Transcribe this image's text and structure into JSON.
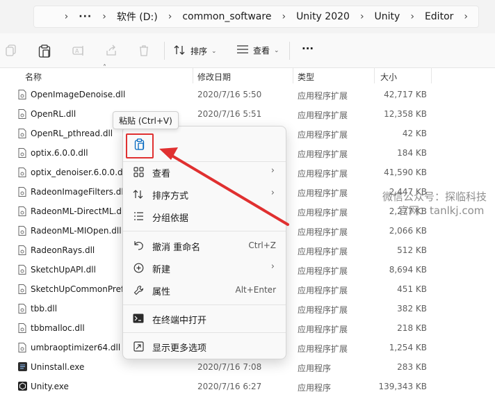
{
  "address": {
    "crumbs": [
      "软件 (D:)",
      "common_software",
      "Unity 2020",
      "Unity",
      "Editor"
    ],
    "overflow": "···"
  },
  "toolbar": {
    "sort_label": "排序",
    "view_label": "查看",
    "more_label": "···"
  },
  "columns": {
    "name": "名称",
    "date": "修改日期",
    "type": "类型",
    "size": "大小"
  },
  "files": [
    {
      "name": "OpenImageDenoise.dll",
      "date": "2020/7/16 5:50",
      "type": "应用程序扩展",
      "size": "42,717 KB",
      "icon": "dll-file-icon"
    },
    {
      "name": "OpenRL.dll",
      "date": "2020/7/16 5:51",
      "type": "应用程序扩展",
      "size": "12,358 KB",
      "icon": "dll-file-icon"
    },
    {
      "name": "OpenRL_pthread.dll",
      "date": "",
      "type": "应用程序扩展",
      "size": "42 KB",
      "icon": "dll-file-icon"
    },
    {
      "name": "optix.6.0.0.dll",
      "date": "",
      "type": "应用程序扩展",
      "size": "184 KB",
      "icon": "dll-file-icon"
    },
    {
      "name": "optix_denoiser.6.0.0.dll",
      "date": "",
      "type": "应用程序扩展",
      "size": "41,590 KB",
      "icon": "dll-file-icon"
    },
    {
      "name": "RadeonImageFilters.dll",
      "date": "",
      "type": "应用程序扩展",
      "size": "2,447 KB",
      "icon": "dll-file-icon"
    },
    {
      "name": "RadeonML-DirectML.dll",
      "date": "",
      "type": "应用程序扩展",
      "size": "2,277 KB",
      "icon": "dll-file-icon"
    },
    {
      "name": "RadeonML-MIOpen.dll",
      "date": "",
      "type": "应用程序扩展",
      "size": "2,066 KB",
      "icon": "dll-file-icon"
    },
    {
      "name": "RadeonRays.dll",
      "date": "",
      "type": "应用程序扩展",
      "size": "512 KB",
      "icon": "dll-file-icon"
    },
    {
      "name": "SketchUpAPI.dll",
      "date": "",
      "type": "应用程序扩展",
      "size": "8,694 KB",
      "icon": "dll-file-icon"
    },
    {
      "name": "SketchUpCommonPreferences.dll",
      "date": "",
      "type": "应用程序扩展",
      "size": "451 KB",
      "icon": "dll-file-icon"
    },
    {
      "name": "tbb.dll",
      "date": "",
      "type": "应用程序扩展",
      "size": "382 KB",
      "icon": "dll-file-icon"
    },
    {
      "name": "tbbmalloc.dll",
      "date": "",
      "type": "应用程序扩展",
      "size": "218 KB",
      "icon": "dll-file-icon"
    },
    {
      "name": "umbraoptimizer64.dll",
      "date": "",
      "type": "应用程序扩展",
      "size": "1,254 KB",
      "icon": "dll-file-icon"
    },
    {
      "name": "Uninstall.exe",
      "date": "2020/7/16 7:08",
      "type": "应用程序",
      "size": "283 KB",
      "icon": "exe-file-icon"
    },
    {
      "name": "Unity.exe",
      "date": "2020/7/16 6:27",
      "type": "应用程序",
      "size": "139,343 KB",
      "icon": "unity-exe-icon"
    }
  ],
  "tooltip": "粘贴 (Ctrl+V)",
  "context_menu": {
    "items": [
      {
        "label": "查看",
        "shortcut": "",
        "submenu": true,
        "icon": "grid-view-icon"
      },
      {
        "label": "排序方式",
        "shortcut": "",
        "submenu": true,
        "icon": "sort-icon"
      },
      {
        "label": "分组依据",
        "shortcut": "",
        "submenu": false,
        "icon": "group-list-icon"
      },
      {
        "label": "撤消 重命名",
        "shortcut": "Ctrl+Z",
        "submenu": false,
        "icon": "undo-icon"
      },
      {
        "label": "新建",
        "shortcut": "",
        "submenu": true,
        "icon": "new-plus-icon"
      },
      {
        "label": "属性",
        "shortcut": "Alt+Enter",
        "submenu": false,
        "icon": "properties-wrench-icon"
      },
      {
        "label": "在终端中打开",
        "shortcut": "",
        "submenu": false,
        "icon": "terminal-icon"
      },
      {
        "label": "显示更多选项",
        "shortcut": "",
        "submenu": false,
        "icon": "more-options-icon"
      }
    ]
  },
  "watermark": {
    "line1": "微信公众号：探临科技",
    "line2": "官网：tanlkj.com"
  },
  "colors": {
    "accent": "#0067c0",
    "highlight": "#e03030"
  }
}
